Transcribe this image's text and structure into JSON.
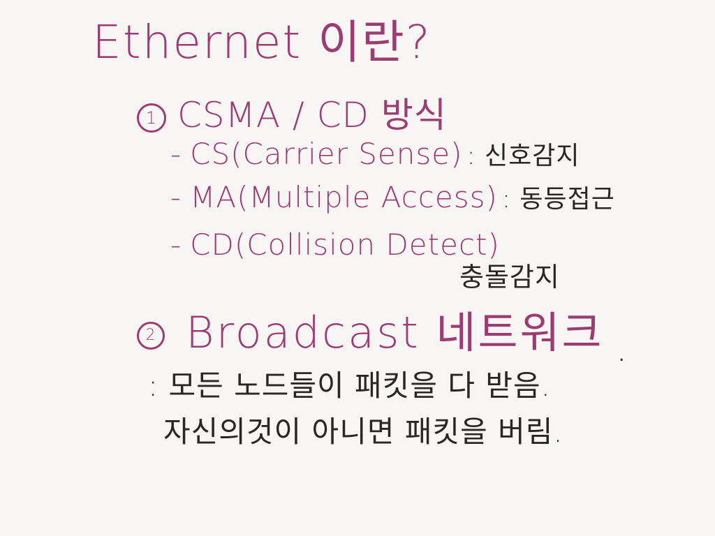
{
  "title": "Ethernet 이란?",
  "section1": {
    "number": "1",
    "heading": "CSMA / CD 방식",
    "bullets": [
      {
        "dash": "-",
        "term": "CS(Carrier Sense)",
        "definition": ": 신호감지"
      },
      {
        "dash": "-",
        "term": "MA(Multiple Access)",
        "definition": ": 동등접근"
      },
      {
        "dash": "-",
        "term": "CD(Collision Detect)",
        "definition": "충돌감지"
      }
    ]
  },
  "section2": {
    "number": "2",
    "heading": "Broadcast 네트워크",
    "trailing_dot": ".",
    "lines": [
      ": 모든 노드들이 패킷을 다 받음.",
      "자신의것이 아니면 패킷을 버림."
    ]
  },
  "colors": {
    "accent": "#9c3d72",
    "ink": "#2b2524",
    "paper": "#f8f6f5"
  }
}
